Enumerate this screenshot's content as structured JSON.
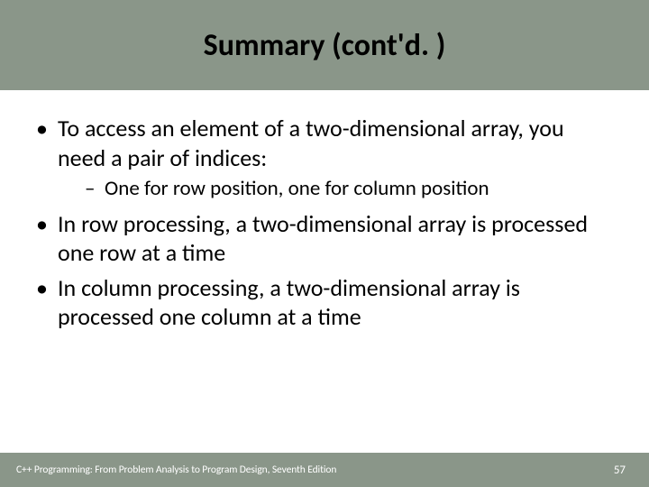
{
  "title": "Summary (cont'd. )",
  "bullets": [
    {
      "text": "To access an element of a two-dimensional array, you need a pair of indices:",
      "sub": [
        "One for row position, one for column position"
      ]
    },
    {
      "text": "In row processing, a two-dimensional array is processed one row at a time",
      "sub": []
    },
    {
      "text": "In column processing, a two-dimensional array is processed one column at a time",
      "sub": []
    }
  ],
  "footer": {
    "source": "C++ Programming: From Problem Analysis to Program Design, Seventh Edition",
    "page": "57"
  }
}
